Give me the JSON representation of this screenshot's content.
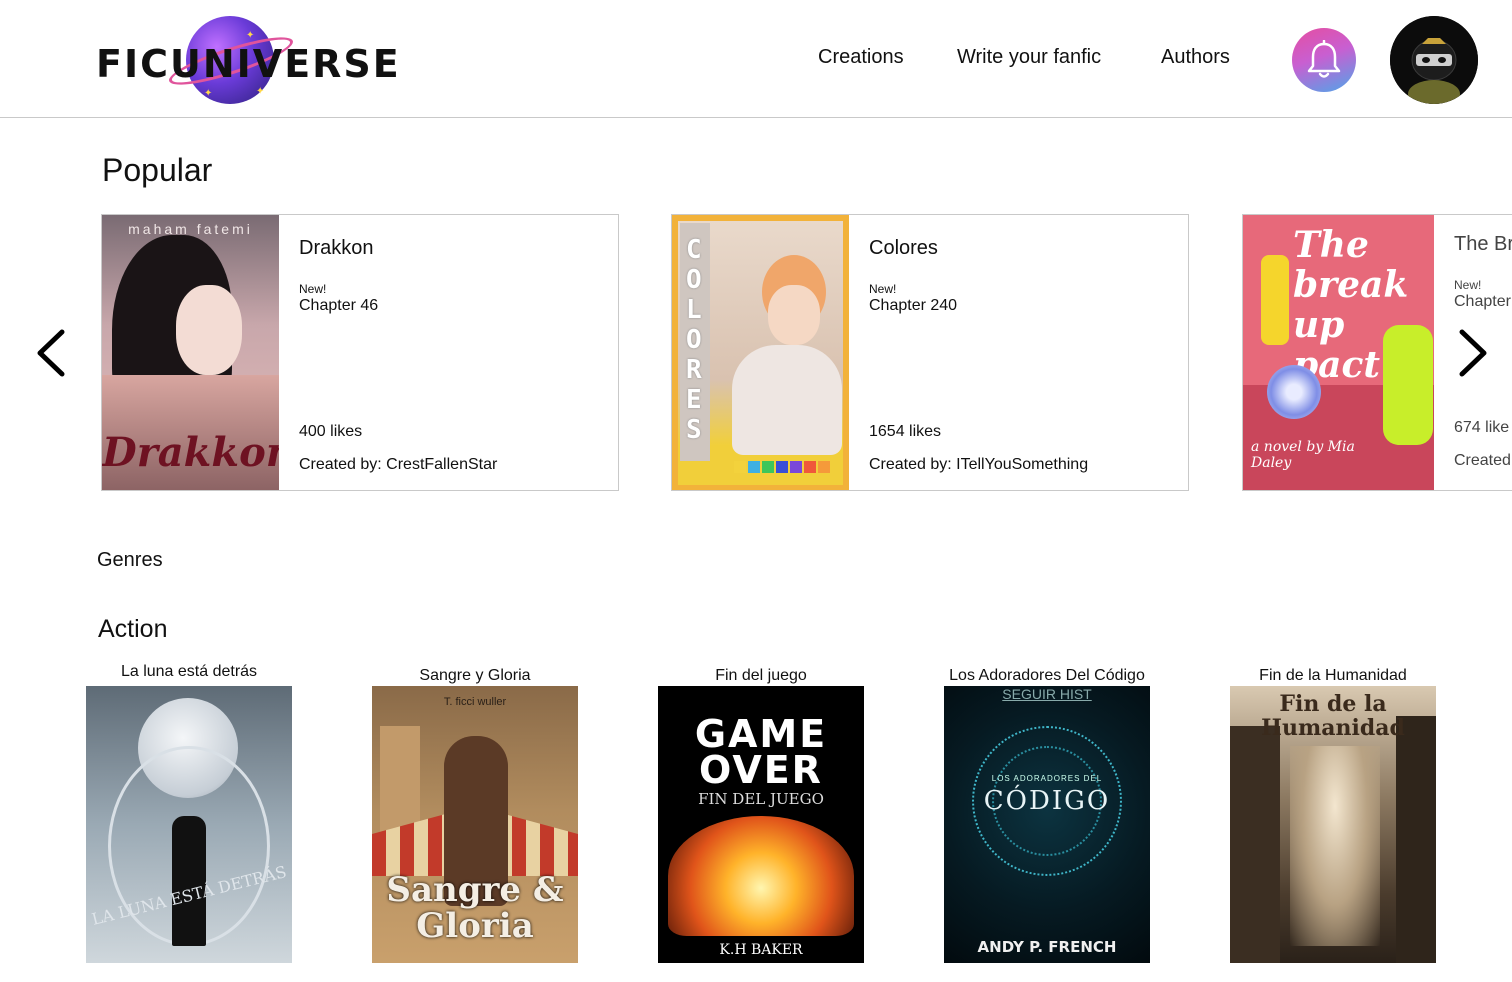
{
  "header": {
    "logo_text": "FICUNIVERSE",
    "nav": [
      "Creations",
      "Write your fanfic",
      "Authors"
    ],
    "icons": {
      "notifications": "bell-icon",
      "profile": "avatar-ninja"
    }
  },
  "popular": {
    "title": "Popular",
    "cards": [
      {
        "title": "Drakkon",
        "new_label": "New!",
        "chapter": "Chapter 46",
        "likes": "400 likes",
        "author": "Created by: CrestFallenStar",
        "cover_top": "maham fatemi",
        "cover_word": "Drakkon"
      },
      {
        "title": "Colores",
        "new_label": "New!",
        "chapter": "Chapter 240",
        "likes": "1654 likes",
        "author": "Created by: ITellYouSomething",
        "cover_word": "COLORES"
      },
      {
        "title": "The Br",
        "new_label": "New!",
        "chapter": "Chapter",
        "likes": "674 like",
        "author": "Created",
        "cover_word": "The break up pact",
        "cover_byline": "a novel by Mia Daley"
      }
    ]
  },
  "genres": {
    "label": "Genres"
  },
  "action": {
    "title": "Action",
    "books": [
      {
        "title": "La luna está detrás",
        "cover_word": "LA LUNA ESTÁ DETRÁS"
      },
      {
        "title": "Sangre y Gloria",
        "cover_top": "T. ficci wuller",
        "cover_word": "Sangre & Gloria"
      },
      {
        "title": "Fin del juego",
        "cover_word": "GAME OVER",
        "cover_sub": "FIN DEL JUEGO",
        "cover_author": "K.H BAKER"
      },
      {
        "title": "Los Adoradores Del Código",
        "cover_top": "SEGUIR HIST",
        "cover_small": "LOS ADORADORES DEL",
        "cover_word": "CÓDIGO",
        "cover_author": "ANDY P. FRENCH"
      },
      {
        "title": "Fin de la Humanidad",
        "cover_word": "Fin de la Humanidad"
      }
    ]
  },
  "colors": {
    "border": "#c9c9c9",
    "bell_gradient_start": "#e54ea1",
    "bell_gradient_end": "#4fa6e9",
    "colores_frame": "#f2b23a"
  }
}
